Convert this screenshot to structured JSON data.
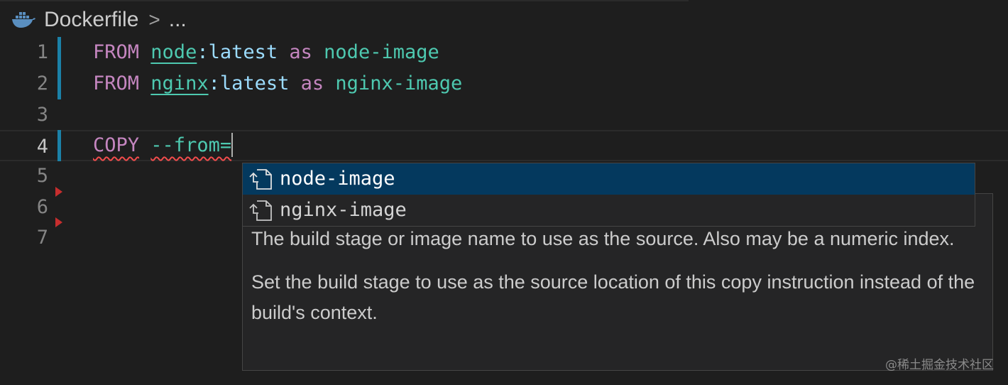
{
  "breadcrumb": {
    "file_name": "Dockerfile",
    "separator": ">",
    "more": "...",
    "file_icon": "docker-whale-icon"
  },
  "editor": {
    "lines": [
      {
        "number": "1",
        "tokens": [
          "FROM",
          "node",
          ":latest",
          "as",
          "node-image"
        ]
      },
      {
        "number": "2",
        "tokens": [
          "FROM",
          "nginx",
          ":latest",
          "as",
          "nginx-image"
        ]
      },
      {
        "number": "3",
        "tokens": []
      },
      {
        "number": "4",
        "tokens": [
          "COPY",
          "--from="
        ]
      },
      {
        "number": "5",
        "tokens": []
      },
      {
        "number": "6",
        "tokens": []
      },
      {
        "number": "7",
        "tokens": []
      }
    ]
  },
  "suggest": {
    "items": [
      {
        "label": "node-image",
        "icon": "file-reference-icon",
        "selected": true
      },
      {
        "label": "nginx-image",
        "icon": "file-reference-icon",
        "selected": false
      }
    ]
  },
  "details": {
    "paragraph1": "The build stage or image name to use as the source. Also may be a numeric index.",
    "paragraph2": "Set the build stage to use as the source location of this copy instruction instead of the build's context."
  },
  "watermark": "@稀土掘金技术社区",
  "colors": {
    "background": "#1e1e1e",
    "keyword": "#c586c0",
    "image_name": "#4ec9b0",
    "tag": "#9cdcfe",
    "selection": "#04395e",
    "git_bar": "#1b81a8",
    "error": "#f14c4c"
  }
}
